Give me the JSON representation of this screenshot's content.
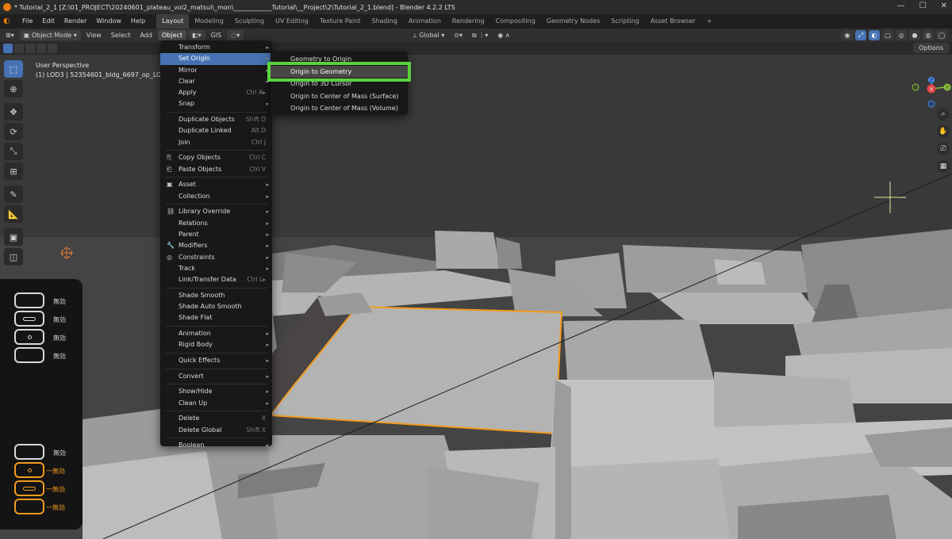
{
  "window": {
    "title": "* Tutorial_2_1 [Z:\\01_PROJECT\\20240601_plateau_vol2_matsui\\_mon\\____________Tutorial\\__Project\\2\\Tutorial_2_1.blend] - Blender 4.2.2 LTS",
    "controls": [
      "—",
      "☐",
      "✕"
    ]
  },
  "menubar": {
    "items": [
      "File",
      "Edit",
      "Render",
      "Window",
      "Help"
    ],
    "workspaces": [
      "Layout",
      "Modeling",
      "Sculpting",
      "UV Editing",
      "Texture Paint",
      "Shading",
      "Animation",
      "Rendering",
      "Compositing",
      "Geometry Nodes",
      "Scripting",
      "Asset Browser",
      "+"
    ],
    "active_workspace": "Layout"
  },
  "header": {
    "mode": "Object Mode",
    "menus": [
      "View",
      "Select",
      "Add",
      "Object"
    ],
    "gis": "GIS",
    "transform_orientation": "Global",
    "options": "Options"
  },
  "viewport": {
    "perspective": "User Perspective",
    "object_info": "(1) LOD3 | 52354601_bldg_6697_op_LOD"
  },
  "object_menu": {
    "items": [
      {
        "label": "Transform",
        "arrow": "▸"
      },
      {
        "label": "Set Origin",
        "arrow": "▸",
        "highlight": true
      },
      {
        "label": "Mirror",
        "arrow": "▸"
      },
      {
        "label": "Clear",
        "arrow": "▸"
      },
      {
        "label": "Apply",
        "shortcut": "Ctrl A▸"
      },
      {
        "label": "Snap",
        "arrow": "▸"
      },
      {
        "sep": true
      },
      {
        "label": "Duplicate Objects",
        "shortcut": "Shift D"
      },
      {
        "label": "Duplicate Linked",
        "shortcut": "Alt D"
      },
      {
        "label": "Join",
        "shortcut": "Ctrl J"
      },
      {
        "sep": true
      },
      {
        "label": "Copy Objects",
        "shortcut": "Ctrl C",
        "icon": "⎘"
      },
      {
        "label": "Paste Objects",
        "shortcut": "Ctrl V",
        "icon": "⎗"
      },
      {
        "sep": true
      },
      {
        "label": "Asset",
        "arrow": "▸",
        "icon": "▣"
      },
      {
        "label": "Collection",
        "arrow": "▸"
      },
      {
        "sep": true
      },
      {
        "label": "Library Override",
        "arrow": "▸",
        "icon": "⛓"
      },
      {
        "label": "Relations",
        "arrow": "▸"
      },
      {
        "label": "Parent",
        "arrow": "▸"
      },
      {
        "label": "Modifiers",
        "arrow": "▸",
        "icon": "🔧"
      },
      {
        "label": "Constraints",
        "arrow": "▸",
        "icon": "◎"
      },
      {
        "label": "Track",
        "arrow": "▸"
      },
      {
        "label": "Link/Transfer Data",
        "shortcut": "Ctrl L▸"
      },
      {
        "sep": true
      },
      {
        "label": "Shade Smooth"
      },
      {
        "label": "Shade Auto Smooth"
      },
      {
        "label": "Shade Flat"
      },
      {
        "sep": true
      },
      {
        "label": "Animation",
        "arrow": "▸"
      },
      {
        "label": "Rigid Body",
        "arrow": "▸"
      },
      {
        "sep": true
      },
      {
        "label": "Quick Effects",
        "arrow": "▸"
      },
      {
        "sep": true
      },
      {
        "label": "Convert",
        "arrow": "▸"
      },
      {
        "sep": true
      },
      {
        "label": "Show/Hide",
        "arrow": "▸"
      },
      {
        "label": "Clean Up",
        "arrow": "▸"
      },
      {
        "sep": true
      },
      {
        "label": "Delete",
        "shortcut": "X"
      },
      {
        "label": "Delete Global",
        "shortcut": "Shift X"
      },
      {
        "sep": true
      },
      {
        "label": "Boolean",
        "arrow": "▸"
      }
    ]
  },
  "set_origin_submenu": {
    "items": [
      {
        "label": "Geometry to Origin"
      },
      {
        "label": "Origin to Geometry",
        "highlight": true
      },
      {
        "label": "Origin to 3D Cursor"
      },
      {
        "label": "Origin to Center of Mass (Surface)"
      },
      {
        "label": "Origin to Center of Mass (Volume)"
      }
    ]
  },
  "gizmo": {
    "x": "X",
    "y": "Y",
    "z": "Z"
  },
  "mouse_overlay": {
    "top_labels": [
      "無効",
      "無効",
      "無効",
      "無効"
    ],
    "bottom_labels": [
      "無効",
      "一無効",
      "一無効",
      "一無効"
    ]
  },
  "colors": {
    "highlight_blue": "#4772b3",
    "selection_orange": "#f29a1d",
    "annotation_green": "#5bd13d",
    "blender_orange": "#e87d0d"
  }
}
